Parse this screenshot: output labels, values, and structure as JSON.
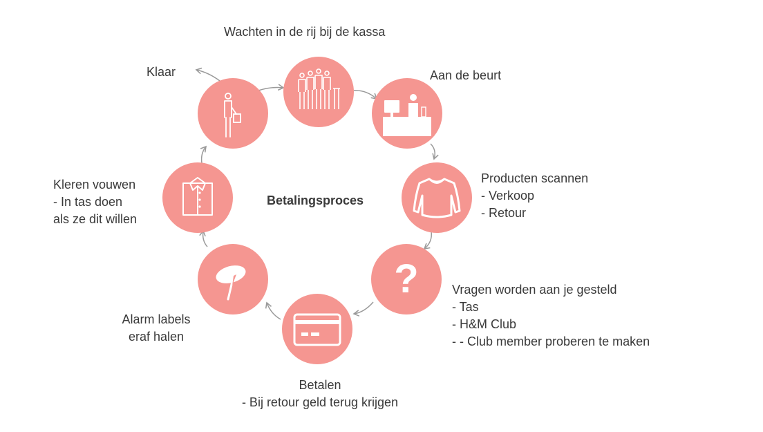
{
  "diagram": {
    "center_title": "Betalingsproces",
    "colors": {
      "circle": "#f59691",
      "icon": "#ffffff",
      "arrow": "#9a9a9a",
      "text": "#3a3a3a"
    },
    "steps": [
      {
        "icon": "queue-icon",
        "lines": [
          "Wachten in de rij bij de kassa"
        ]
      },
      {
        "icon": "cashier-desk-icon",
        "lines": [
          "Aan de beurt"
        ]
      },
      {
        "icon": "sweater-icon",
        "lines": [
          "Producten scannen",
          "- Verkoop",
          "- Retour"
        ]
      },
      {
        "icon": "question-mark-icon",
        "lines": [
          "Vragen worden aan je gesteld",
          "- Tas",
          "- H&M Club",
          "- - Club member proberen te maken"
        ]
      },
      {
        "icon": "payment-card-icon",
        "lines": [
          "Betalen",
          "- Bij retour geld terug krijgen"
        ]
      },
      {
        "icon": "security-tag-icon",
        "lines": [
          "Alarm labels",
          "eraf halen"
        ]
      },
      {
        "icon": "folded-shirt-icon",
        "lines": [
          "Kleren vouwen",
          "- In tas doen",
          "als ze dit willen"
        ]
      },
      {
        "icon": "shopper-with-bag-icon",
        "lines": [
          "Klaar"
        ]
      }
    ]
  }
}
